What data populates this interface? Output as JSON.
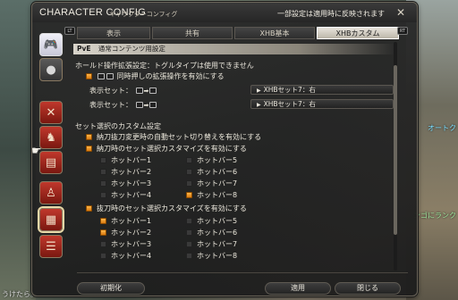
{
  "window": {
    "title_en": "CHARACTER CONFIG",
    "title_jp": "キャラクターコンフィグ",
    "notice": "一部設定は適用時に反映されます"
  },
  "tabs": [
    {
      "label": "表示",
      "active": false
    },
    {
      "label": "共有",
      "active": false
    },
    {
      "label": "XHB基本",
      "active": false
    },
    {
      "label": "XHBカスタム",
      "active": true
    }
  ],
  "bumpers": {
    "left": "LT",
    "right": "RT"
  },
  "section": {
    "prefix": "PvE",
    "title": "通常コンテンツ用設定"
  },
  "hold": {
    "heading": "ホールド操作拡張設定：トグルタイプは使用できません",
    "toggle_label": "同時押しの拡張操作を有効にする",
    "toggle_checked": true,
    "display_set_label": "表示セット：",
    "rows": [
      {
        "button": "XHBセット7：右"
      },
      {
        "button": "XHBセット7：右"
      }
    ]
  },
  "custom": {
    "heading": "セット選択のカスタム設定",
    "opt1": {
      "label": "納刀抜刀変更時の自動セット切り替えを有効にする",
      "checked": true
    },
    "opt2": {
      "label": "納刀時のセット選択カスタマイズを有効にする",
      "checked": true
    },
    "sheathed": [
      {
        "label": "ホットバー1",
        "checked": false
      },
      {
        "label": "ホットバー5",
        "checked": false
      },
      {
        "label": "ホットバー2",
        "checked": false
      },
      {
        "label": "ホットバー6",
        "checked": false
      },
      {
        "label": "ホットバー3",
        "checked": false
      },
      {
        "label": "ホットバー7",
        "checked": false
      },
      {
        "label": "ホットバー4",
        "checked": false
      },
      {
        "label": "ホットバー8",
        "checked": true
      }
    ],
    "opt3": {
      "label": "抜刀時のセット選択カスタマイズを有効にする",
      "checked": true
    },
    "drawn": [
      {
        "label": "ホットバー1",
        "checked": true
      },
      {
        "label": "ホットバー5",
        "checked": false
      },
      {
        "label": "ホットバー2",
        "checked": true
      },
      {
        "label": "ホットバー6",
        "checked": false
      },
      {
        "label": "ホットバー3",
        "checked": false
      },
      {
        "label": "ホットバー7",
        "checked": false
      },
      {
        "label": "ホットバー4",
        "checked": false
      },
      {
        "label": "ホットバー8",
        "checked": false
      }
    ]
  },
  "footer": {
    "reset": "初期化",
    "apply": "適用",
    "close": "閉じる"
  },
  "background_text": {
    "right_top": "オートク",
    "right_mid": "ンゴにランク",
    "left_bottom": "うけたら。"
  },
  "colors": {
    "checkbox_on": "#f0a030",
    "active_tab": "#e0dcd2",
    "accent_red": "#b0302a"
  },
  "side_icons": [
    "gamepad-icon",
    "character-icon",
    "crossed-swords-icon",
    "chocobo-icon",
    "id-card-icon",
    "person-icon",
    "hotbar-icon",
    "chat-icon"
  ]
}
